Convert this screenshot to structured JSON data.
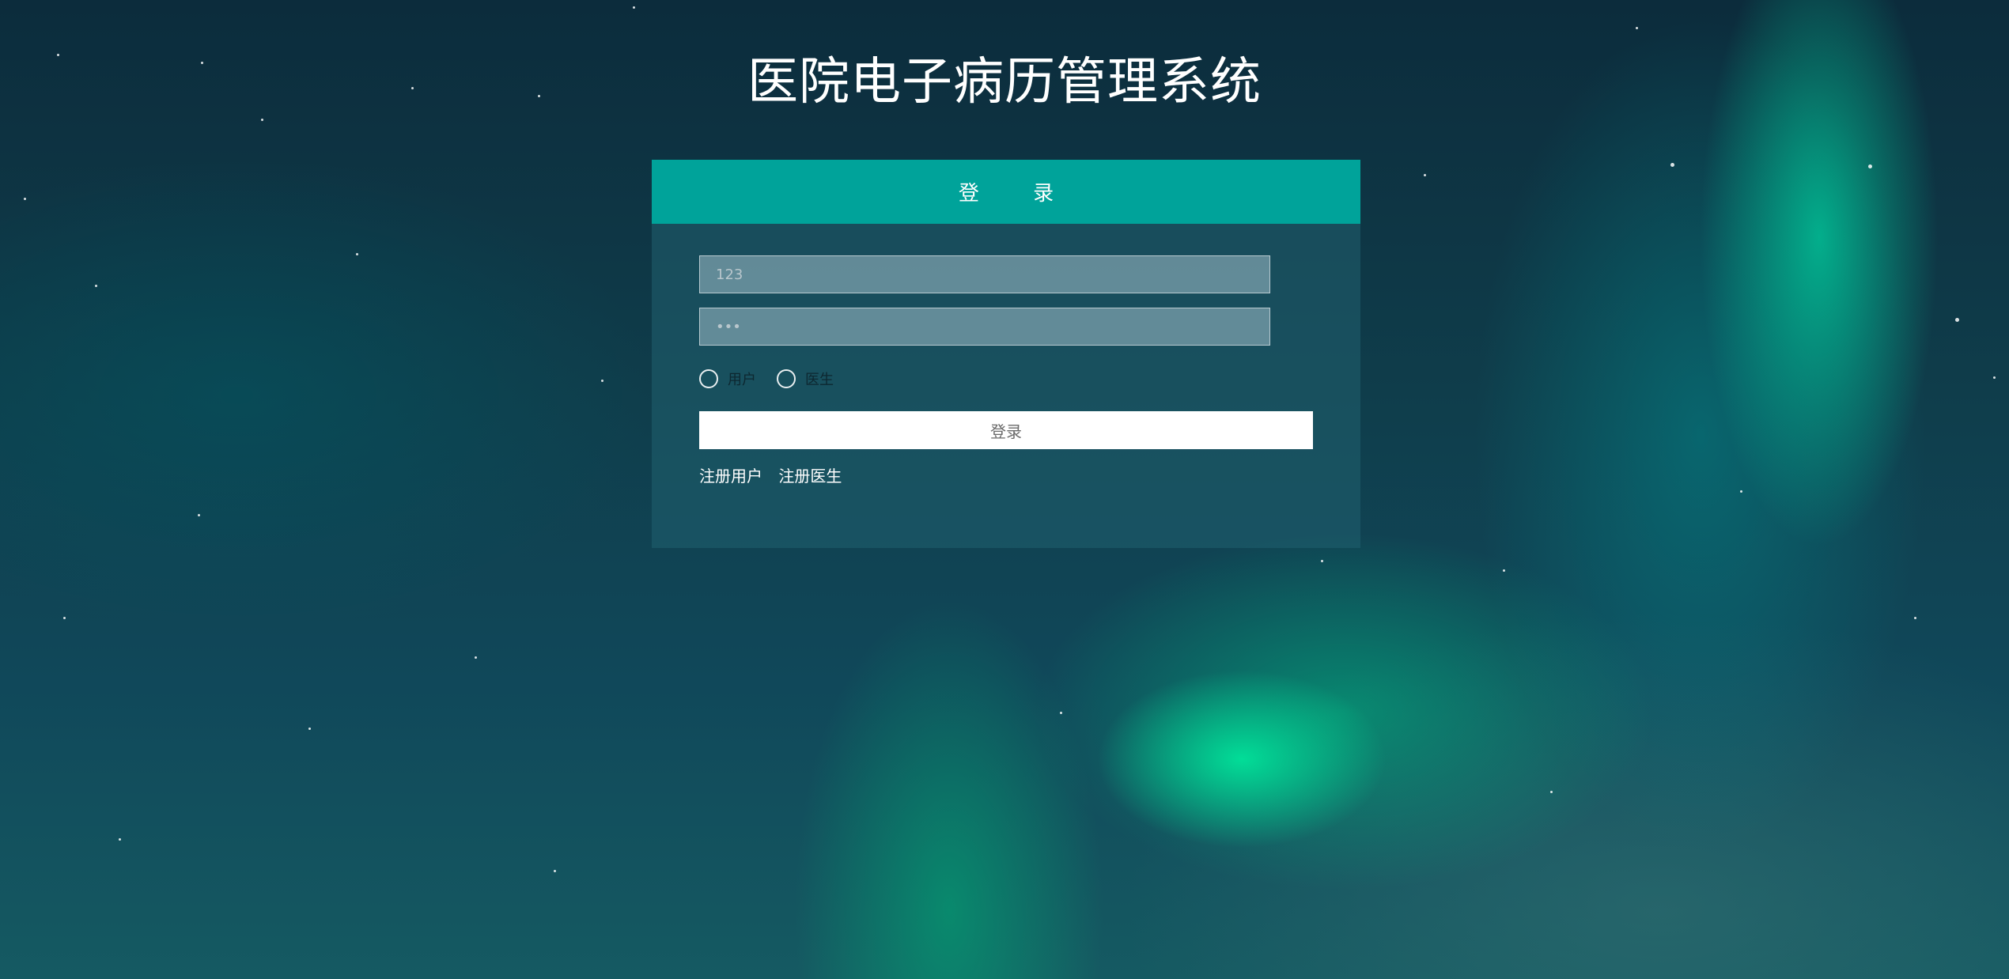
{
  "page": {
    "title": "医院电子病历管理系统"
  },
  "login_card": {
    "header": "登 录",
    "username": {
      "value": "",
      "placeholder": "123"
    },
    "password": {
      "value": "",
      "placeholder": "•••"
    },
    "roles": [
      {
        "label": "用户",
        "selected": false
      },
      {
        "label": "医生",
        "selected": false
      }
    ],
    "submit_label": "登录",
    "links": {
      "register_user": "注册用户",
      "register_doctor": "注册医生"
    }
  },
  "colors": {
    "header_bg": "#00a39a",
    "card_bg": "rgba(32, 96, 112, 0.55)",
    "button_bg": "#ffffff"
  }
}
